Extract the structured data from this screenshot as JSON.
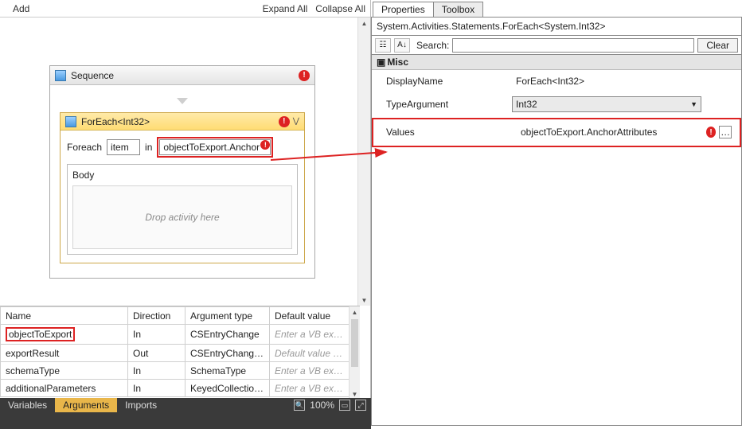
{
  "left_toolbar": {
    "add": "Add",
    "expand": "Expand All",
    "collapse": "Collapse All"
  },
  "sequence": {
    "title": "Sequence",
    "foreach": {
      "title": "ForEach<Int32>",
      "foreach_lbl": "Foreach",
      "item_value": "item",
      "in_lbl": "in",
      "expr_value": "objectToExport.Anchor",
      "body_lbl": "Body",
      "drop_hint": "Drop activity here"
    }
  },
  "arguments": {
    "headers": {
      "name": "Name",
      "dir": "Direction",
      "type": "Argument type",
      "def": "Default value"
    },
    "rows": [
      {
        "name": "objectToExport",
        "dir": "In",
        "type": "CSEntryChange",
        "def": "Enter a VB express",
        "ph": true,
        "hl": true
      },
      {
        "name": "exportResult",
        "dir": "Out",
        "type": "CSEntryChangeRes",
        "def": "Default value not su",
        "ph": true,
        "hl": false
      },
      {
        "name": "schemaType",
        "dir": "In",
        "type": "SchemaType",
        "def": "Enter a VB express",
        "ph": true,
        "hl": false
      },
      {
        "name": "additionalParameters",
        "dir": "In",
        "type": "KeyedCollection<S",
        "def": "Enter a VB express",
        "ph": true,
        "hl": false
      }
    ]
  },
  "bottom_tabs": {
    "variables": "Variables",
    "arguments": "Arguments",
    "imports": "Imports",
    "percent": "100%"
  },
  "right": {
    "tabs": {
      "properties": "Properties",
      "toolbox": "Toolbox"
    },
    "type_line": "System.Activities.Statements.ForEach<System.Int32>",
    "search_lbl": "Search:",
    "clear": "Clear",
    "category": "Misc",
    "rows": {
      "display": {
        "name": "DisplayName",
        "value": "ForEach<Int32>"
      },
      "typearg": {
        "name": "TypeArgument",
        "value": "Int32"
      },
      "values": {
        "name": "Values",
        "value": "objectToExport.AnchorAttributes"
      }
    }
  }
}
